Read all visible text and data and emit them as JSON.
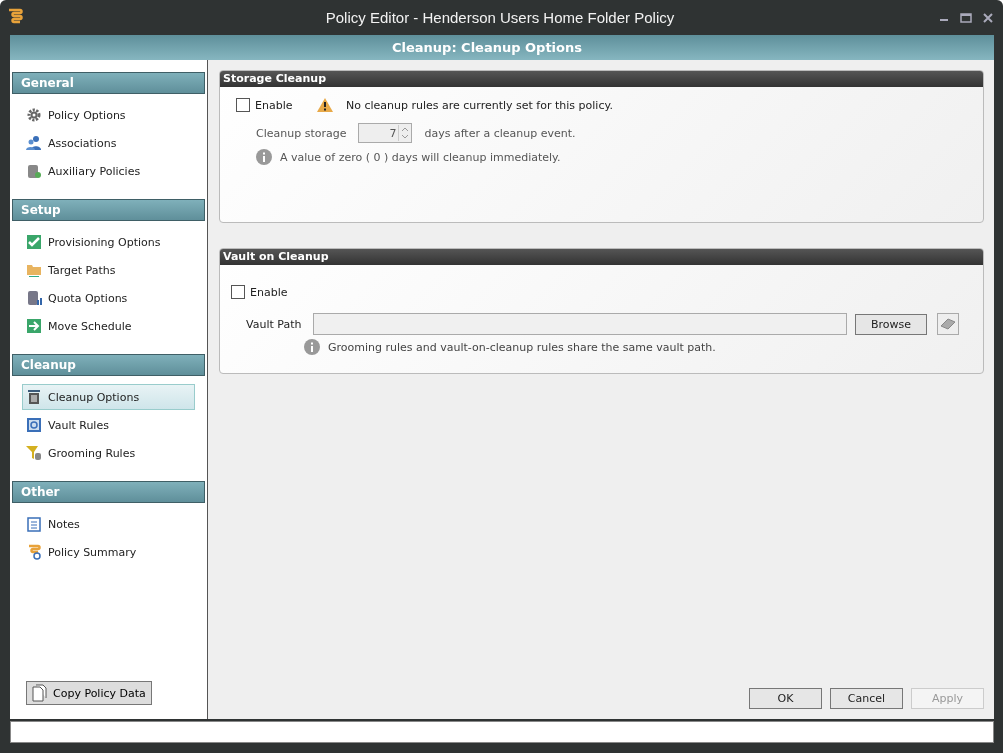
{
  "window": {
    "title": "Policy Editor - Henderson Users Home Folder Policy"
  },
  "header": {
    "title": "Cleanup: Cleanup Options"
  },
  "sidebar": {
    "sections": [
      {
        "title": "General",
        "items": [
          {
            "label": "Policy Options",
            "kind": "gear",
            "selected": false
          },
          {
            "label": "Associations",
            "kind": "people",
            "selected": false
          },
          {
            "label": "Auxiliary Policies",
            "kind": "database",
            "selected": false
          }
        ]
      },
      {
        "title": "Setup",
        "items": [
          {
            "label": "Provisioning Options",
            "kind": "check",
            "selected": false
          },
          {
            "label": "Target Paths",
            "kind": "folder",
            "selected": false
          },
          {
            "label": "Quota Options",
            "kind": "quota",
            "selected": false
          },
          {
            "label": "Move Schedule",
            "kind": "arrow",
            "selected": false
          }
        ]
      },
      {
        "title": "Cleanup",
        "items": [
          {
            "label": "Cleanup Options",
            "kind": "trash",
            "selected": true
          },
          {
            "label": "Vault Rules",
            "kind": "vault",
            "selected": false
          },
          {
            "label": "Grooming Rules",
            "kind": "funnel",
            "selected": false
          }
        ]
      },
      {
        "title": "Other",
        "items": [
          {
            "label": "Notes",
            "kind": "notes",
            "selected": false
          },
          {
            "label": "Policy Summary",
            "kind": "summary",
            "selected": false
          }
        ]
      }
    ],
    "copy_button": "Copy Policy Data"
  },
  "storage_cleanup": {
    "title": "Storage Cleanup",
    "enable": {
      "label": "Enable",
      "checked": false
    },
    "warning": "No cleanup rules are currently set for this policy.",
    "cleanup_label": "Cleanup storage",
    "days_value": "7",
    "days_suffix": "days after a cleanup event.",
    "info": "A value of zero ( 0 ) days will cleanup immediately."
  },
  "vault_on_cleanup": {
    "title": "Vault on Cleanup",
    "enable": {
      "label": "Enable",
      "checked": false
    },
    "path_label": "Vault Path",
    "browse": "Browse",
    "info": "Grooming rules and vault-on-cleanup rules share the same vault path."
  },
  "buttons": [
    {
      "label": "OK",
      "disabled": false
    },
    {
      "label": "Cancel",
      "disabled": false
    },
    {
      "label": "Apply",
      "disabled": true
    }
  ]
}
